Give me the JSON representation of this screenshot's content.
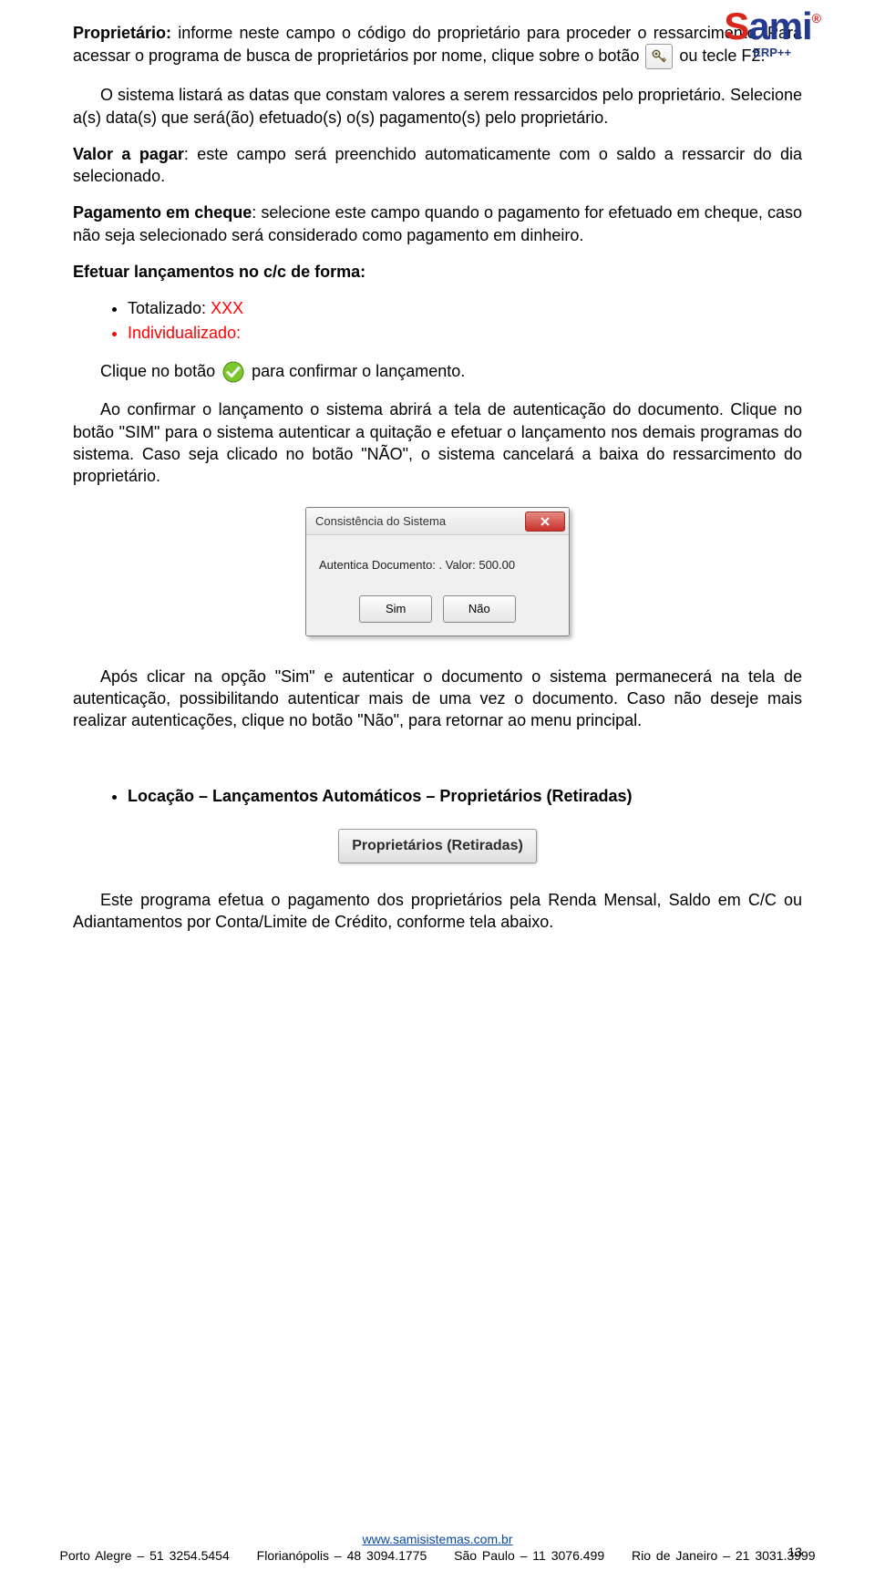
{
  "logo": {
    "brand_s": "S",
    "brand_ami": "ami",
    "reg": "®",
    "sub": "ERP++"
  },
  "p1": {
    "label": "Proprietário:",
    "txt_a": " informe neste campo o código do proprietário para proceder o ressarcimento. Para acessar o programa de busca de proprietários por nome, clique sobre o botão ",
    "txt_b": " ou tecle F2."
  },
  "p2": "O sistema listará as datas que constam valores a serem ressarcidos pelo proprietário. Selecione a(s) data(s) que será(ão) efetuado(s) o(s) pagamento(s) pelo proprietário.",
  "p3": {
    "label": "Valor a pagar",
    "txt": ": este campo será preenchido automaticamente com o saldo a ressarcir do dia selecionado."
  },
  "p4": {
    "label": "Pagamento em cheque",
    "txt": ": selecione este campo quando o pagamento for efetuado em cheque, caso não seja selecionado será considerado como pagamento em dinheiro."
  },
  "p5_label": "Efetuar lançamentos no c/c de forma:",
  "bullets": {
    "a_label": "Totalizado:",
    "a_val": " XXX",
    "b_label": "Individualizado:"
  },
  "p6": {
    "a": "Clique no botão ",
    "b": " para confirmar o lançamento."
  },
  "p7": "Ao confirmar o lançamento o sistema abrirá a tela de autenticação do documento. Clique no botão \"SIM\" para o sistema autenticar a quitação e efetuar o lançamento nos demais programas do sistema. Caso seja clicado no botão \"NÃO\", o sistema cancelará a baixa do ressarcimento do proprietário.",
  "dialog": {
    "title": "Consistência do Sistema",
    "message": "Autentica Documento: . Valor: 500.00",
    "btn_yes": "Sim",
    "btn_no": "Não"
  },
  "p8": "Após clicar na opção \"Sim\" e autenticar o documento o sistema permanecerá na tela de autenticação, possibilitando autenticar mais de uma vez o documento. Caso não deseje mais realizar autenticações, clique no botão \"Não\", para retornar ao menu principal.",
  "section_bullet": "Locação – Lançamentos Automáticos – Proprietários (Retiradas)",
  "section_btn": "Proprietários (Retiradas)",
  "p9": "Este programa efetua o pagamento dos proprietários pela Renda Mensal, Saldo em C/C ou Adiantamentos por Conta/Limite de Crédito, conforme tela abaixo.",
  "footer": {
    "url": "www.samisistemas.com.br",
    "c1": "Porto Alegre – 51 3254.5454",
    "c2": "Florianópolis – 48 3094.1775",
    "c3": "São Paulo – 11 3076.499",
    "c4": "Rio de Janeiro – 21 3031.3999"
  },
  "page_number": "13"
}
